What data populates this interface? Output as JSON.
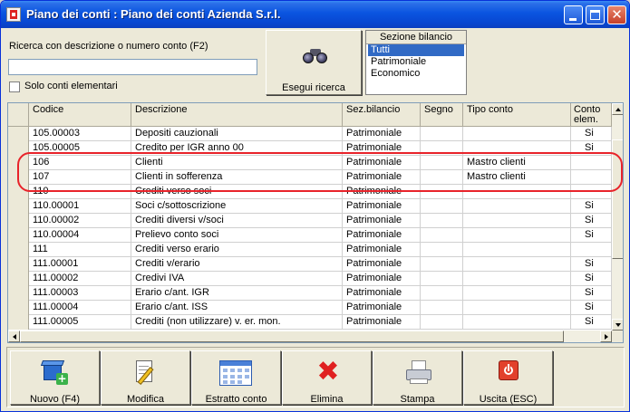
{
  "window": {
    "title": "Piano dei conti : Piano dei conti Azienda S.r.l."
  },
  "search": {
    "label": "Ricerca con descrizione o numero conto (F2)",
    "value": "",
    "placeholder": "",
    "only_elementary_label": "Solo conti elementari",
    "only_elementary_checked": false,
    "button_label": "Esegui ricerca",
    "button_icon": "binoculars-icon"
  },
  "sezione": {
    "header": "Sezione bilancio",
    "options": [
      "Tutti",
      "Patrimoniale",
      "Economico"
    ],
    "selected": "Tutti"
  },
  "grid": {
    "headers": [
      "Codice",
      "Descrizione",
      "Sez.bilancio",
      "Segno",
      "Tipo conto",
      "Conto elem."
    ],
    "rows": [
      [
        "105.00003",
        "Depositi cauzionali",
        "Patrimoniale",
        "",
        "",
        "Si"
      ],
      [
        "105.00005",
        "Credito per IGR anno 00",
        "Patrimoniale",
        "",
        "",
        "Si"
      ],
      [
        "106",
        "Clienti",
        "Patrimoniale",
        "",
        "Mastro clienti",
        ""
      ],
      [
        "107",
        "Clienti in sofferenza",
        "Patrimoniale",
        "",
        "Mastro clienti",
        ""
      ],
      [
        "110",
        "Crediti verso soci",
        "Patrimoniale",
        "",
        "",
        ""
      ],
      [
        "110.00001",
        "Soci c/sottoscrizione",
        "Patrimoniale",
        "",
        "",
        "Si"
      ],
      [
        "110.00002",
        "Crediti diversi v/soci",
        "Patrimoniale",
        "",
        "",
        "Si"
      ],
      [
        "110.00004",
        "Prelievo conto soci",
        "Patrimoniale",
        "",
        "",
        "Si"
      ],
      [
        "111",
        "Crediti verso erario",
        "Patrimoniale",
        "",
        "",
        ""
      ],
      [
        "111.00001",
        "Crediti v/erario",
        "Patrimoniale",
        "",
        "",
        "Si"
      ],
      [
        "111.00002",
        "Credivi IVA",
        "Patrimoniale",
        "",
        "",
        "Si"
      ],
      [
        "111.00003",
        "Erario c/ant. IGR",
        "Patrimoniale",
        "",
        "",
        "Si"
      ],
      [
        "111.00004",
        "Erario c/ant. ISS",
        "Patrimoniale",
        "",
        "",
        "Si"
      ],
      [
        "111.00005",
        "Crediti (non utilizzare) v. er. mon.",
        "Patrimoniale",
        "",
        "",
        "Si"
      ]
    ]
  },
  "toolbar": {
    "buttons": [
      {
        "label": "Nuovo (F4)",
        "icon": "new-folder-icon"
      },
      {
        "label": "Modifica",
        "icon": "edit-icon"
      },
      {
        "label": "Estratto conto",
        "icon": "calendar-icon"
      },
      {
        "label": "Elimina",
        "icon": "delete-icon"
      },
      {
        "label": "Stampa",
        "icon": "printer-icon"
      },
      {
        "label": "Uscita (ESC)",
        "icon": "exit-icon"
      }
    ]
  },
  "colors": {
    "titlebar": "#0a54e0",
    "selection": "#316ac5",
    "highlight": "#e8232a",
    "window_bg": "#ece9d8"
  }
}
